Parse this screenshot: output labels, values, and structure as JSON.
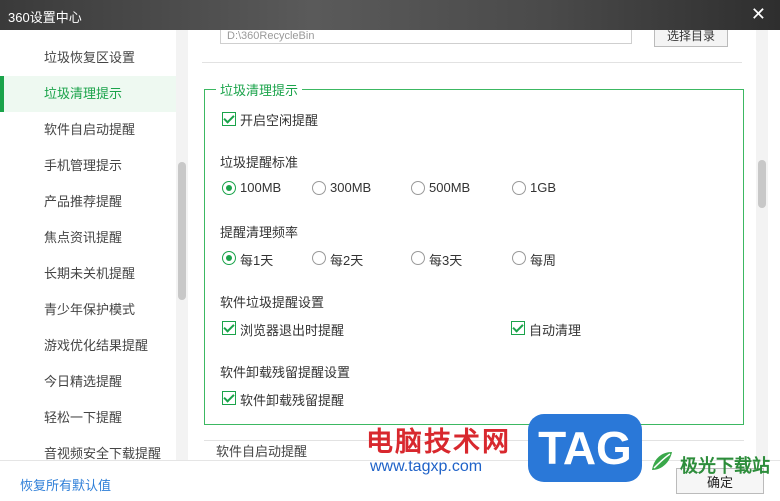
{
  "window": {
    "title": "360设置中心"
  },
  "sidebar": {
    "items": [
      {
        "label": "垃圾恢复区设置"
      },
      {
        "label": "垃圾清理提示"
      },
      {
        "label": "软件自启动提醒"
      },
      {
        "label": "手机管理提示"
      },
      {
        "label": "产品推荐提醒"
      },
      {
        "label": "焦点资讯提醒"
      },
      {
        "label": "长期未关机提醒"
      },
      {
        "label": "青少年保护模式"
      },
      {
        "label": "游戏优化结果提醒"
      },
      {
        "label": "今日精选提醒"
      },
      {
        "label": "轻松一下提醒"
      },
      {
        "label": "音视频安全下载提醒"
      }
    ],
    "active_index": 1
  },
  "recycle": {
    "path": "D:\\360RecycleBin",
    "choose_label": "选择目录"
  },
  "group": {
    "title": "垃圾清理提示",
    "enable_idle": {
      "label": "开启空闲提醒",
      "checked": true
    },
    "threshold": {
      "heading": "垃圾提醒标准",
      "options": [
        "100MB",
        "300MB",
        "500MB",
        "1GB"
      ],
      "selected": "100MB"
    },
    "frequency": {
      "heading": "提醒清理频率",
      "options": [
        "每1天",
        "每2天",
        "每3天",
        "每周"
      ],
      "selected": "每1天"
    },
    "software_junk": {
      "heading": "软件垃圾提醒设置",
      "browser_exit": {
        "label": "浏览器退出时提醒",
        "checked": true
      },
      "auto_clean": {
        "label": "自动清理",
        "checked": true
      }
    },
    "uninstall": {
      "heading": "软件卸载残留提醒设置",
      "residual": {
        "label": "软件卸载残留提醒",
        "checked": true
      }
    }
  },
  "next_section": {
    "title": "软件自启动提醒"
  },
  "footer": {
    "restore_label": "恢复所有默认值",
    "ok_label": "确定"
  },
  "watermark": {
    "line1": "电脑技术网",
    "line2": "www.tagxp.com",
    "tag": "TAG",
    "brand": "极光下载站"
  },
  "colors": {
    "accent": "#1aa34a",
    "link": "#2f7fd8"
  }
}
